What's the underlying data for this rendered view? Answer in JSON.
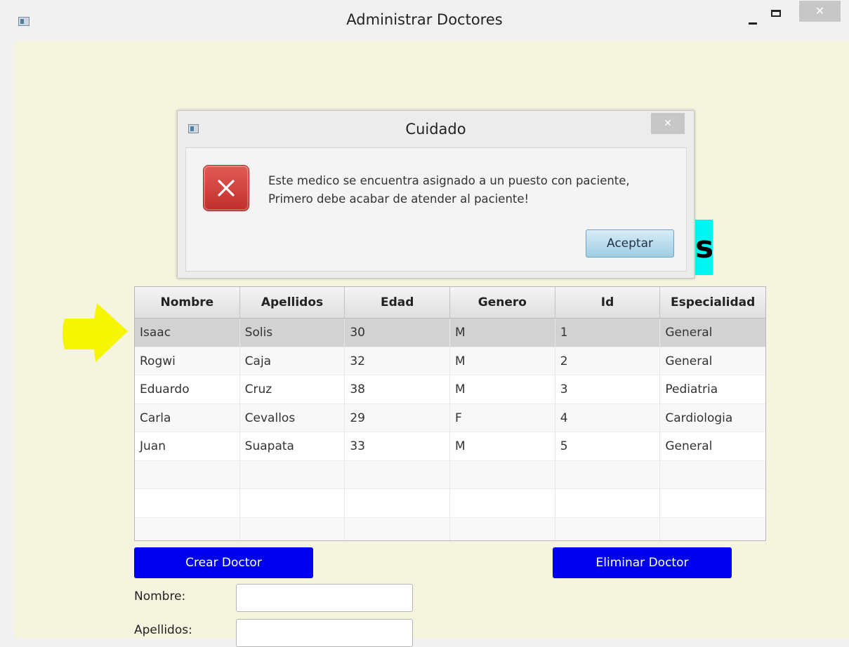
{
  "window": {
    "title": "Administrar Doctores",
    "controls": {
      "minimize": "–",
      "maximize": "☐",
      "close": "✕"
    }
  },
  "background_heading_fragment": "s",
  "table": {
    "columns": [
      "Nombre",
      "Apellidos",
      "Edad",
      "Genero",
      "Id",
      "Especialidad"
    ],
    "rows": [
      [
        "Isaac",
        "Solis",
        "30",
        "M",
        "1",
        "General"
      ],
      [
        "Rogwi",
        "Caja",
        "32",
        "M",
        "2",
        "General"
      ],
      [
        "Eduardo",
        "Cruz",
        "38",
        "M",
        "3",
        "Pediatria"
      ],
      [
        "Carla",
        "Cevallos",
        "29",
        "F",
        "4",
        "Cardiologia"
      ],
      [
        "Juan",
        "Suapata",
        "33",
        "M",
        "5",
        "General"
      ]
    ],
    "selected_row": 0
  },
  "buttons": {
    "create": "Crear Doctor",
    "delete": "Eliminar Doctor"
  },
  "form": {
    "nombre_label": "Nombre:",
    "nombre_value": "",
    "apellidos_label": "Apellidos:",
    "apellidos_value": ""
  },
  "dialog": {
    "title": "Cuidado",
    "message_line1": "Este medico se encuentra asignado a un puesto con paciente,",
    "message_line2": "Primero debe acabar de atender al paciente!",
    "ok_label": "Aceptar",
    "close": "✕",
    "icon": "error-x-icon"
  },
  "colors": {
    "content_bg": "#f4f4df",
    "button_blue": "#0000f0",
    "highlight_cyan": "#00f5f5",
    "arrow_yellow": "#f6f600",
    "error_red": "#d2423d"
  }
}
